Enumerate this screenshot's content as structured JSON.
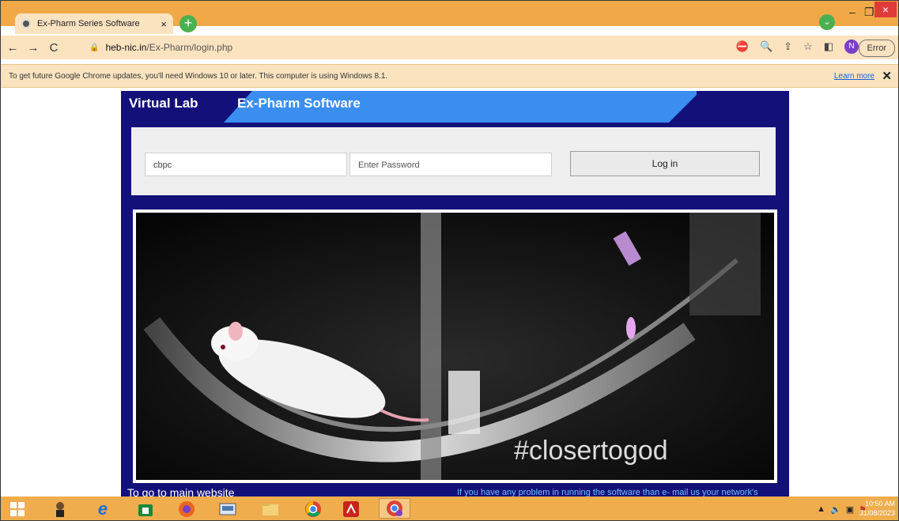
{
  "browser": {
    "tab_title": "Ex-Pharm Series Software",
    "tab_close": "×",
    "new_tab": "+",
    "url_host": "heb-nic.in",
    "url_path": "/Ex-Pharm/login.php",
    "profile_initial": "N",
    "error_label": "Error",
    "window_controls": {
      "minimize": "–",
      "restore": "❐",
      "close": "×"
    }
  },
  "infobar": {
    "message": "To get future Google Chrome updates, you'll need Windows 10 or later. This computer is using Windows 8.1.",
    "learn_more": "Learn more",
    "dismiss": "✕"
  },
  "page": {
    "virtual_lab_title": "Virtual Lab",
    "software_title": "Ex-Pharm Software",
    "username_value": "cbpc",
    "password_placeholder": "Enter Password",
    "login_button": "Log in",
    "image_caption": "#closertogod",
    "footer_left": "To go to main website",
    "footer_right": "If you have any problem in running the software than e- mail us your network's"
  },
  "taskbar": {
    "clock_time": "10:50 AM",
    "clock_date": "31/08/2023"
  },
  "colors": {
    "tabstrip": "#f1a948",
    "toolbar": "#fbe3c0",
    "panel": "#14107a",
    "banner": "#3a8ef0",
    "taskbar": "#f0ad4e"
  }
}
